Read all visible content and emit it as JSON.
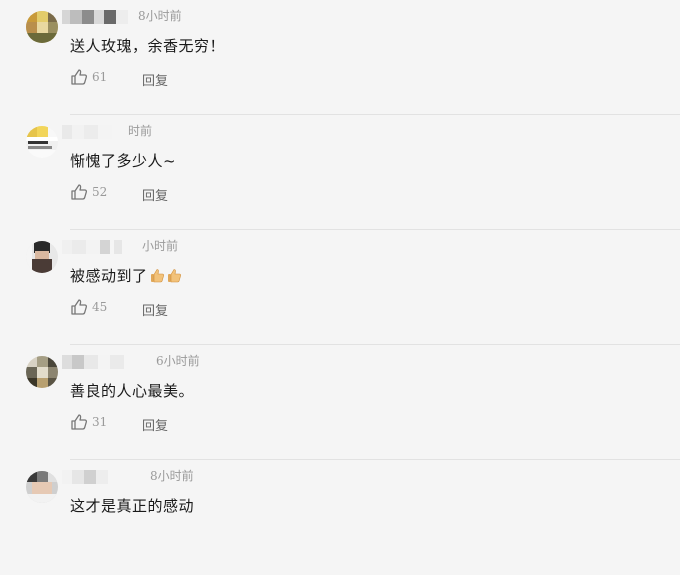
{
  "colors": {
    "background": "#f5f5f5",
    "meta": "#9a9a9a",
    "text": "#1a1a1a"
  },
  "icons": {
    "like": "thumbs-up-icon",
    "emoji": "thumbs-up-emoji"
  },
  "reply_label": "回复",
  "comments": [
    {
      "time": "8小时前",
      "content": "送人玫瑰，余香无穷！",
      "likes": "61"
    },
    {
      "time": "时前",
      "content": "惭愧了多少人~",
      "likes": "52"
    },
    {
      "time": "小时前",
      "content": "被感动到了",
      "likes": "45"
    },
    {
      "time": "6小时前",
      "content": "善良的人心最美。",
      "likes": "31"
    },
    {
      "time": "8小时前",
      "content": "这才是真正的感动",
      "likes": ""
    }
  ]
}
